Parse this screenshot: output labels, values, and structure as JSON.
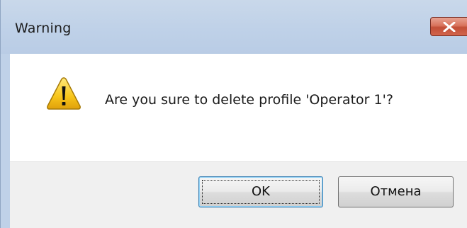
{
  "dialog": {
    "title": "Warning",
    "message": "Are you sure to delete profile 'Operator 1'?",
    "icon": "warning-triangle-icon",
    "close_icon": "close-icon"
  },
  "buttons": {
    "ok_label": "OK",
    "cancel_label": "Отмена"
  },
  "colors": {
    "titlebar": "#bfd1e8",
    "close_button": "#c24f37",
    "content_bg": "#ffffff",
    "footer_bg": "#f0f0f0",
    "ok_focus_border": "#3c7fb1"
  }
}
